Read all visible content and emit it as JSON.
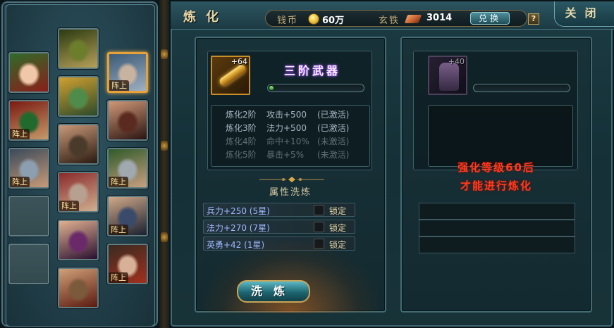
{
  "left_panel": {
    "portraits": [
      {
        "slot": "r1c1",
        "badge": "",
        "colors": [
          "#f0c7a8",
          "#2f6a2a",
          "#8a1f1a"
        ]
      },
      {
        "slot": "r1c2",
        "badge": "",
        "colors": [
          "#6c7d2c",
          "#2b3a10",
          "#b6a05a"
        ]
      },
      {
        "slot": "r1c3",
        "badge": "阵上",
        "colors": [
          "#c8b2a0",
          "#3b5a77",
          "#9fb0c0"
        ]
      },
      {
        "slot": "r2c1",
        "badge": "阵上",
        "colors": [
          "#1f6a2c",
          "#7a1a12",
          "#c59a6a"
        ]
      },
      {
        "slot": "r2c2",
        "badge": "",
        "colors": [
          "#4f8c4c",
          "#d0a030",
          "#2d4a2a"
        ]
      },
      {
        "slot": "r2c3",
        "badge": "",
        "colors": [
          "#5a2a20",
          "#d09878",
          "#2a1410"
        ]
      },
      {
        "slot": "r3c1",
        "badge": "阵上",
        "colors": [
          "#8c9fb0",
          "#3a4a5a",
          "#c89a78"
        ]
      },
      {
        "slot": "r3c2",
        "badge": "",
        "colors": [
          "#4a3a2a",
          "#c89878",
          "#2a1a10"
        ]
      },
      {
        "slot": "r3c3",
        "badge": "阵上",
        "colors": [
          "#a0a8b0",
          "#2f5a2a",
          "#c8a080"
        ]
      },
      {
        "slot": "r4c1",
        "badge": "",
        "colors": []
      },
      {
        "slot": "r4c2",
        "badge": "阵上",
        "colors": [
          "#b8a090",
          "#8a2a2a",
          "#d0b090"
        ]
      },
      {
        "slot": "r4c3",
        "badge": "阵上",
        "colors": [
          "#3a4a6a",
          "#d0a888",
          "#1a2030"
        ]
      },
      {
        "slot": "r5c1",
        "badge": "",
        "colors": []
      },
      {
        "slot": "r5c2",
        "badge": "",
        "colors": [
          "#6a2a6a",
          "#e0b090",
          "#2a1030"
        ]
      },
      {
        "slot": "r5c3",
        "badge": "阵上",
        "colors": [
          "#d8b098",
          "#3a2a20",
          "#a03020"
        ]
      },
      {
        "slot": "r6c2",
        "badge": "",
        "colors": [
          "#7a5a3a",
          "#d0a078",
          "#5a1a10"
        ]
      }
    ]
  },
  "header": {
    "title": "炼化",
    "coins_label": "钱币",
    "coins_value": "60万",
    "iron_label": "玄铁",
    "iron_value": "3014",
    "exchange_label": "兑换",
    "help_label": "?",
    "close_label": "关闭"
  },
  "left_pane": {
    "item": {
      "plus": "+64",
      "name": "三阶武器",
      "progress": 0.02
    },
    "refine_levels": [
      {
        "level": "炼化2阶",
        "effect": "攻击+500",
        "status": "(已激活)",
        "active": true
      },
      {
        "level": "炼化3阶",
        "effect": "法力+500",
        "status": "(已激活)",
        "active": true
      },
      {
        "level": "炼化4阶",
        "effect": "命中+10%",
        "status": "(未激活)",
        "active": false
      },
      {
        "level": "炼化5阶",
        "effect": "暴击+5%",
        "status": "(未激活)",
        "active": false
      }
    ],
    "section_title": "属性洗炼",
    "attributes": [
      {
        "text": "兵力+250 (5星)",
        "lock_label": "锁定"
      },
      {
        "text": "法力+270 (7星)",
        "lock_label": "锁定"
      },
      {
        "text": "英勇+42 (1星)",
        "lock_label": "锁定"
      }
    ],
    "wash_button": "洗炼"
  },
  "right_pane": {
    "item": {
      "plus": "+40",
      "progress": 0
    },
    "notice_line1": "强化等级60后",
    "notice_line2": "才能进行炼化"
  },
  "colors": {
    "accent_gold": "#c98e2c",
    "active_text": "#a6b6c0",
    "inactive_text": "#5f6f74",
    "notice_red": "#ff3b1f",
    "attr_blue": "#9fb8ff"
  }
}
